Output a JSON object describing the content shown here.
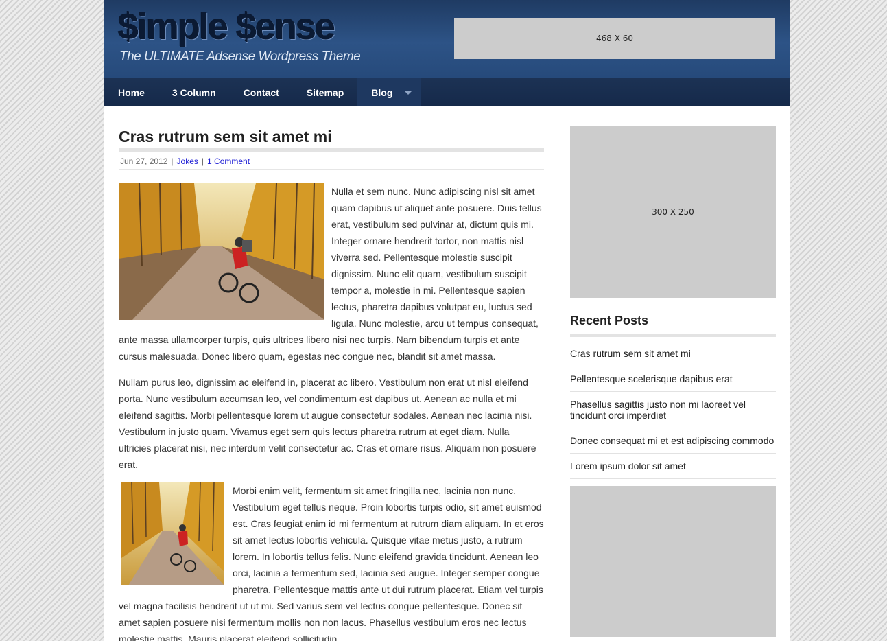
{
  "header": {
    "logo_title": "$imple $ense",
    "logo_tagline": "The ULTIMATE Adsense Wordpress Theme",
    "banner_ad_label": "468 X 60"
  },
  "nav": {
    "items": [
      {
        "label": "Home"
      },
      {
        "label": "3 Column"
      },
      {
        "label": "Contact"
      },
      {
        "label": "Sitemap"
      },
      {
        "label": "Blog"
      }
    ]
  },
  "post": {
    "title": "Cras rutrum sem sit amet mi",
    "date": "Jun 27, 2012",
    "category": "Jokes",
    "comments": "1 Comment",
    "meta_separator": "|",
    "paragraphs": [
      "Nulla et sem nunc. Nunc adipiscing nisl sit amet quam dapibus ut aliquet ante posuere. Duis tellus erat, vestibulum sed pulvinar at, dictum quis mi. Integer ornare hendrerit tortor, non mattis nisl viverra sed. Pellentesque molestie suscipit dignissim. Nunc elit quam, vestibulum suscipit tempor a, molestie in mi. Pellentesque sapien lectus, pharetra dapibus volutpat eu, luctus sed ligula. Nunc molestie, arcu ut tempus consequat, ante massa ullamcorper turpis, quis ultrices libero nisi nec turpis. Nam bibendum turpis et ante cursus malesuada. Donec libero quam, egestas nec congue nec, blandit sit amet massa.",
      "Nullam purus leo, dignissim ac eleifend in, placerat ac libero. Vestibulum non erat ut nisl eleifend porta. Nunc vestibulum accumsan leo, vel condimentum est dapibus ut. Aenean ac nulla et mi eleifend sagittis. Morbi pellentesque lorem ut augue consectetur sodales. Aenean nec lacinia nisi. Vestibulum in justo quam. Vivamus eget sem quis lectus pharetra rutrum at eget diam. Nulla ultricies placerat nisi, nec interdum velit consectetur ac. Cras et ornare risus. Aliquam non posuere erat.",
      "Morbi enim velit, fermentum sit amet fringilla nec, lacinia non nunc. Vestibulum eget tellus neque. Proin lobortis turpis odio, sit amet euismod est. Cras feugiat enim id mi fermentum at rutrum diam aliquam. In et eros sit amet lectus lobortis vehicula. Quisque vitae metus justo, a rutrum lorem. In lobortis tellus felis. Nunc eleifend gravida tincidunt. Aenean leo orci, lacinia a fermentum sed, lacinia sed augue. Integer semper congue pharetra. Pellentesque mattis ante ut dui rutrum placerat. Etiam vel turpis vel magna facilisis hendrerit ut ut mi. Sed varius sem vel lectus congue pellentesque. Donec sit amet sapien posuere nisi fermentum mollis non non lacus. Phasellus vestibulum eros nec lectus molestie mattis. Mauris placerat eleifend sollicitudin."
    ]
  },
  "sidebar": {
    "square_ad_label": "300 X 250",
    "recent_posts_title": "Recent Posts",
    "recent_posts": [
      "Cras rutrum sem sit amet mi",
      "Pellentesque scelerisque dapibus erat",
      "Phasellus sagittis justo non mi laoreet vel tincidunt orci imperdiet",
      "Donec consequat mi et est adipiscing commodo",
      "Lorem ipsum dolor sit amet"
    ]
  },
  "colors": {
    "header_blue": "#264a7b",
    "nav_navy": "#15294a",
    "link_blue": "#1a1ad4",
    "ad_gray": "#cccccc"
  }
}
